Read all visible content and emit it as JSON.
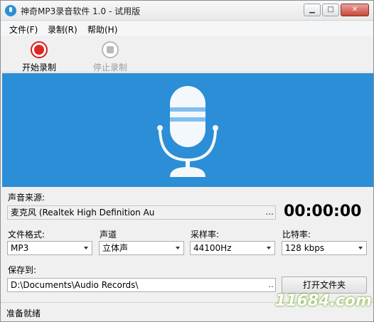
{
  "window": {
    "title": "神奇MP3录音软件 1.0 - 试用版",
    "controls": {
      "minimize": "▁",
      "maximize": "□",
      "close": "✕"
    }
  },
  "menu": [
    {
      "label": "文件(F)"
    },
    {
      "label": "录制(R)"
    },
    {
      "label": "帮助(H)"
    }
  ],
  "toolbar": {
    "start_label": "开始录制",
    "stop_label": "停止录制",
    "start_icon": "record-icon",
    "stop_icon": "stop-icon"
  },
  "banner": {
    "icon": "microphone-icon",
    "color": "#2b8ed6"
  },
  "source": {
    "label": "声音来源:",
    "value": "麦克风 (Realtek High Definition Au",
    "browse": "..."
  },
  "timer": "00:00:00",
  "format": {
    "label": "文件格式:",
    "value": "MP3"
  },
  "channel": {
    "label": "声道",
    "value": "立体声"
  },
  "samplerate": {
    "label": "采样率:",
    "value": "44100Hz"
  },
  "bitrate": {
    "label": "比特率:",
    "value": "128 kbps"
  },
  "saveto": {
    "label": "保存到:",
    "value": "D:\\Documents\\Audio Records\\",
    "browse": "..",
    "open_button": "打开文件夹"
  },
  "status": "准备就绪",
  "watermark": {
    "text": "11684.com"
  }
}
